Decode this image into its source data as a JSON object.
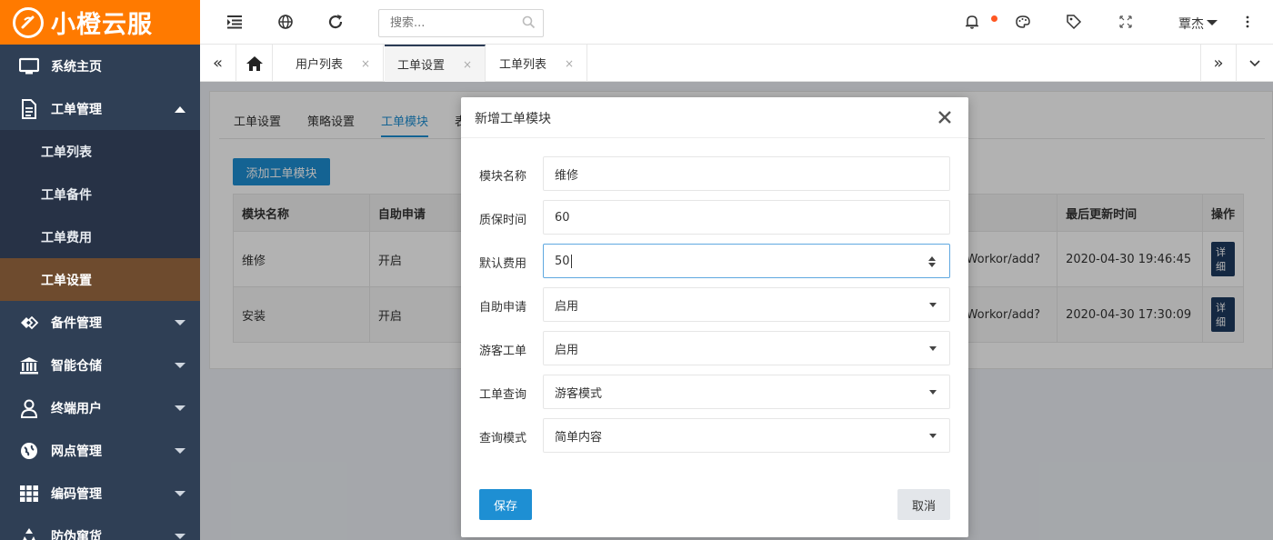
{
  "brand": {
    "name": "小橙云服",
    "accent": "#ff7a00"
  },
  "sidebar": {
    "items": [
      {
        "label": "系统主页",
        "icon": "monitor-icon"
      },
      {
        "label": "工单管理",
        "icon": "document-icon",
        "expanded": true,
        "children": [
          {
            "label": "工单列表"
          },
          {
            "label": "工单备件"
          },
          {
            "label": "工单费用"
          },
          {
            "label": "工单设置",
            "active": true
          }
        ]
      },
      {
        "label": "备件管理",
        "icon": "diamond-icon"
      },
      {
        "label": "智能仓储",
        "icon": "bank-icon"
      },
      {
        "label": "终端用户",
        "icon": "user-icon"
      },
      {
        "label": "网点管理",
        "icon": "globe-icon"
      },
      {
        "label": "编码管理",
        "icon": "grid-icon"
      },
      {
        "label": "防伪窜货",
        "icon": "recycle-icon"
      }
    ]
  },
  "topbar": {
    "search_placeholder": "搜索...",
    "user_name": "覃杰"
  },
  "tabs": {
    "items": [
      {
        "label": "用户列表"
      },
      {
        "label": "工单设置",
        "active": true
      },
      {
        "label": "工单列表"
      }
    ],
    "close_glyph": "×"
  },
  "content": {
    "sub_tabs": [
      {
        "label": "工单设置"
      },
      {
        "label": "策略设置"
      },
      {
        "label": "工单模块",
        "active": true
      },
      {
        "label": "表"
      }
    ],
    "add_button": "添加工单模块",
    "table": {
      "headers": [
        "模块名称",
        "自助申请",
        "",
        "最后更新时间",
        "操作"
      ],
      "rows": [
        {
          "name": "维修",
          "self_apply": "开启",
          "url_fragment": "Workor/add?",
          "updated": "2020-04-30 19:46:45",
          "action": "详细"
        },
        {
          "name": "安装",
          "self_apply": "开启",
          "url_fragment": "Workor/add?",
          "updated": "2020-04-30 17:30:09",
          "action": "详细"
        }
      ]
    }
  },
  "modal": {
    "title": "新增工单模块",
    "fields": [
      {
        "label": "模块名称",
        "value": "维修",
        "type": "text"
      },
      {
        "label": "质保时间",
        "value": "60",
        "type": "text"
      },
      {
        "label": "默认费用",
        "value": "50",
        "type": "number"
      },
      {
        "label": "自助申请",
        "value": "启用",
        "type": "select"
      },
      {
        "label": "游客工单",
        "value": "启用",
        "type": "select"
      },
      {
        "label": "工单查询",
        "value": "游客模式",
        "type": "select"
      },
      {
        "label": "查询模式",
        "value": "简单内容",
        "type": "select"
      }
    ],
    "save_label": "保存",
    "cancel_label": "取消"
  }
}
